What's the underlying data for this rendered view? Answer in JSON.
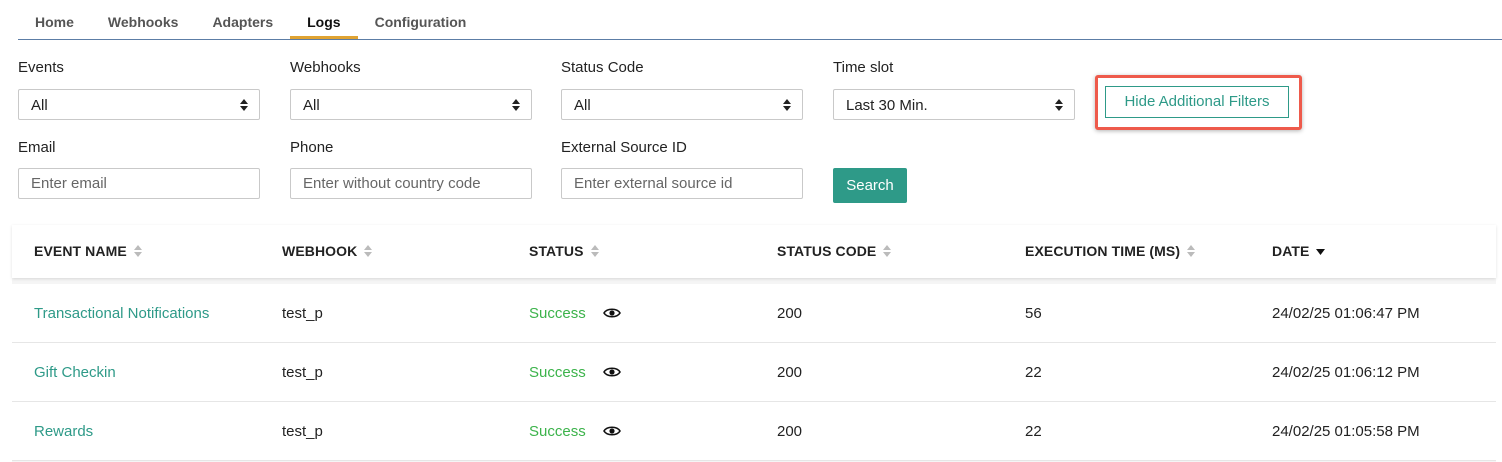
{
  "tabs": [
    {
      "label": "Home",
      "active": false
    },
    {
      "label": "Webhooks",
      "active": false
    },
    {
      "label": "Adapters",
      "active": false
    },
    {
      "label": "Logs",
      "active": true
    },
    {
      "label": "Configuration",
      "active": false
    }
  ],
  "filters": {
    "events": {
      "label": "Events",
      "value": "All"
    },
    "webhooks": {
      "label": "Webhooks",
      "value": "All"
    },
    "status_code": {
      "label": "Status Code",
      "value": "All"
    },
    "time_slot": {
      "label": "Time slot",
      "value": "Last 30 Min."
    },
    "email": {
      "label": "Email",
      "placeholder": "Enter email"
    },
    "phone": {
      "label": "Phone",
      "placeholder": "Enter without country code"
    },
    "external_source_id": {
      "label": "External Source ID",
      "placeholder": "Enter external source id"
    },
    "hide_filters_label": "Hide Additional Filters",
    "search_label": "Search"
  },
  "table": {
    "columns": [
      "EVENT NAME",
      "WEBHOOK",
      "STATUS",
      "STATUS CODE",
      "EXECUTION TIME (MS)",
      "DATE"
    ],
    "rows": [
      {
        "event": "Transactional Notifications",
        "webhook": "test_p",
        "status": "Success",
        "status_code": "200",
        "exec_time": "56",
        "date": "24/02/25 01:06:47 PM"
      },
      {
        "event": "Gift Checkin",
        "webhook": "test_p",
        "status": "Success",
        "status_code": "200",
        "exec_time": "22",
        "date": "24/02/25 01:06:12 PM"
      },
      {
        "event": "Rewards",
        "webhook": "test_p",
        "status": "Success",
        "status_code": "200",
        "exec_time": "22",
        "date": "24/02/25 01:05:58 PM"
      }
    ]
  },
  "colors": {
    "accent": "#2e9a88",
    "tab_underline": "#e0a332",
    "success": "#3cb34b",
    "highlight": "#ee5a4b"
  }
}
